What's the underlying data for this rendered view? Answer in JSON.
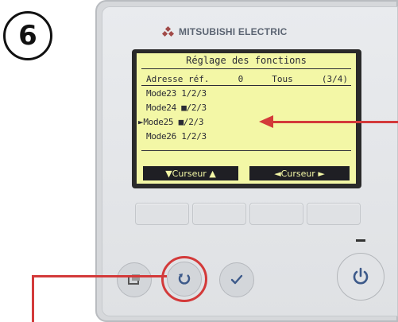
{
  "step_number": "6",
  "brand": "MITSUBISHI ELECTRIC",
  "lcd": {
    "title": "Réglage des fonctions",
    "header": {
      "address": "Adresse réf.",
      "value": "0",
      "scope": "Tous",
      "page": "(3/4)"
    },
    "rows": [
      {
        "label": "Mode23",
        "value": "1/2/3"
      },
      {
        "label": "Mode24",
        "value": "■/2/3"
      },
      {
        "label": "►Mode25",
        "value": "■/2/3"
      },
      {
        "label": "Mode26",
        "value": "1/2/3"
      }
    ],
    "softkeys": {
      "left": "▼Curseur ▲",
      "right": "◄Curseur ►"
    }
  },
  "colors": {
    "lcd_bg": "#f3f7a6",
    "accent": "#d33a3a",
    "panel": "#e6e8eb"
  },
  "buttons": {
    "menu": "menu-icon",
    "return": "return-icon",
    "confirm": "check-icon",
    "power": "power-icon"
  }
}
